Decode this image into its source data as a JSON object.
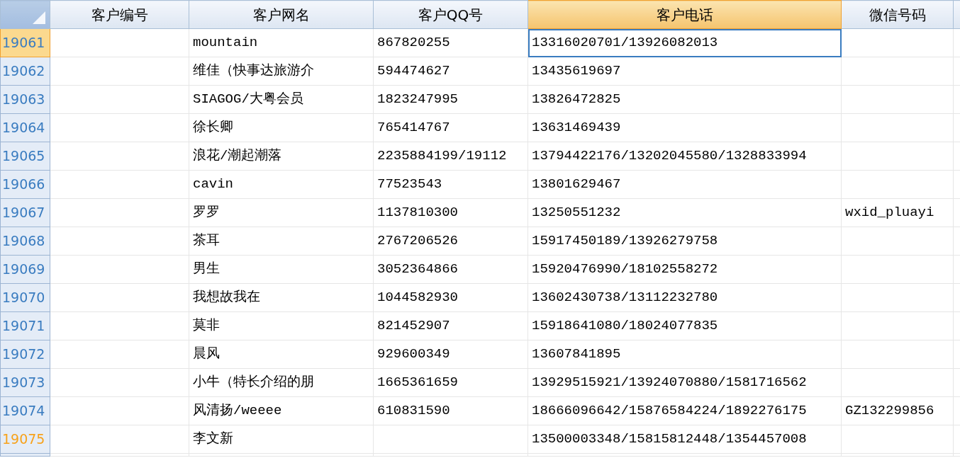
{
  "columns": [
    {
      "label": "客户编号",
      "selected": false
    },
    {
      "label": "客户网名",
      "selected": false
    },
    {
      "label": "客户QQ号",
      "selected": false
    },
    {
      "label": "客户电话",
      "selected": true
    },
    {
      "label": "微信号码",
      "selected": false
    }
  ],
  "rows": [
    {
      "row_number": "19061",
      "selected": true,
      "modified": false,
      "focused": true,
      "cells": [
        null,
        "mountain",
        "867820255",
        "13316020701/13926082013",
        null
      ]
    },
    {
      "row_number": "19062",
      "selected": false,
      "modified": false,
      "focused": false,
      "cells": [
        null,
        "维佳（快事达旅游介",
        "594474627",
        "13435619697",
        null
      ]
    },
    {
      "row_number": "19063",
      "selected": false,
      "modified": false,
      "focused": false,
      "cells": [
        null,
        "SIAGOG/大粤会员",
        "1823247995",
        "13826472825",
        null
      ]
    },
    {
      "row_number": "19064",
      "selected": false,
      "modified": false,
      "focused": false,
      "cells": [
        null,
        "徐长卿",
        "765414767",
        "13631469439",
        null
      ]
    },
    {
      "row_number": "19065",
      "selected": false,
      "modified": false,
      "focused": false,
      "cells": [
        null,
        "浪花/潮起潮落",
        "2235884199/19112",
        "13794422176/13202045580/1328833994",
        null
      ]
    },
    {
      "row_number": "19066",
      "selected": false,
      "modified": false,
      "focused": false,
      "cells": [
        null,
        "cavin",
        "77523543",
        "13801629467",
        null
      ]
    },
    {
      "row_number": "19067",
      "selected": false,
      "modified": false,
      "focused": false,
      "cells": [
        null,
        "罗罗",
        "1137810300",
        "13250551232",
        "wxid_pluayi"
      ]
    },
    {
      "row_number": "19068",
      "selected": false,
      "modified": false,
      "focused": false,
      "cells": [
        null,
        "茶耳",
        "2767206526",
        "15917450189/13926279758",
        null
      ]
    },
    {
      "row_number": "19069",
      "selected": false,
      "modified": false,
      "focused": false,
      "cells": [
        null,
        "男生",
        "3052364866",
        "15920476990/18102558272",
        null
      ]
    },
    {
      "row_number": "19070",
      "selected": false,
      "modified": false,
      "focused": false,
      "cells": [
        null,
        "我想故我在",
        "1044582930",
        "13602430738/13112232780",
        null
      ]
    },
    {
      "row_number": "19071",
      "selected": false,
      "modified": false,
      "focused": false,
      "cells": [
        null,
        "莫非",
        "821452907",
        "15918641080/18024077835",
        null
      ]
    },
    {
      "row_number": "19072",
      "selected": false,
      "modified": false,
      "focused": false,
      "cells": [
        null,
        "晨风",
        "929600349",
        "13607841895",
        null
      ]
    },
    {
      "row_number": "19073",
      "selected": false,
      "modified": false,
      "focused": false,
      "cells": [
        null,
        "小牛（特长介绍的朋",
        "1665361659",
        "13929515921/13924070880/1581716562",
        null
      ]
    },
    {
      "row_number": "19074",
      "selected": false,
      "modified": false,
      "focused": false,
      "cells": [
        null,
        "风清扬/weeee",
        "610831590",
        "18666096642/15876584224/1892276175",
        "GZ132299856"
      ]
    },
    {
      "row_number": "19075",
      "selected": false,
      "modified": true,
      "focused": false,
      "cells": [
        null,
        "李文新",
        null,
        "13500003348/15815812448/1354457008",
        null
      ]
    }
  ]
}
